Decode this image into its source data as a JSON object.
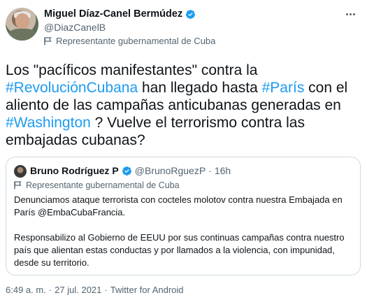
{
  "author": {
    "display_name": "Miguel Díaz-Canel Bermúdez",
    "handle": "@DiazCanelB",
    "label": "Representante gubernamental de Cuba"
  },
  "tweet": {
    "text_1": "Los \"pacíficos manifestantes\" contra la ",
    "hashtag_1": "#RevoluciónCubana",
    "text_2": "  han llegado hasta ",
    "hashtag_2": "#París",
    "text_3": "  con el aliento de las campañas anticubanas generadas en ",
    "hashtag_3": "#Washington",
    "text_4": " ? Vuelve el terrorismo contra las embajadas cubanas?"
  },
  "quote": {
    "display_name": "Bruno Rodríguez P",
    "handle": "@BrunoRguezP",
    "separator": "·",
    "time": "16h",
    "label": "Representante gubernamental de Cuba",
    "paragraph_1": "Denunciamos ataque terrorista con cocteles molotov contra nuestra Embajada en París @EmbaCubaFrancia.",
    "paragraph_2": "Responsabilizo al Gobierno de EEUU por sus continuas campañas contra nuestro país que alientan estas conductas y por llamados a la violencia, con impunidad, desde su territorio."
  },
  "footer": {
    "time": "6:49 a. m.",
    "sep1": "·",
    "date": "27 jul. 2021",
    "sep2": "·",
    "source": "Twitter for Android"
  },
  "colors": {
    "link": "#1d9bf0",
    "verified": "#1d9bf0",
    "secondary_text": "#536471"
  },
  "icons": {
    "verified": "verified-badge-icon",
    "label": "flag-icon",
    "menu": "more-icon"
  }
}
